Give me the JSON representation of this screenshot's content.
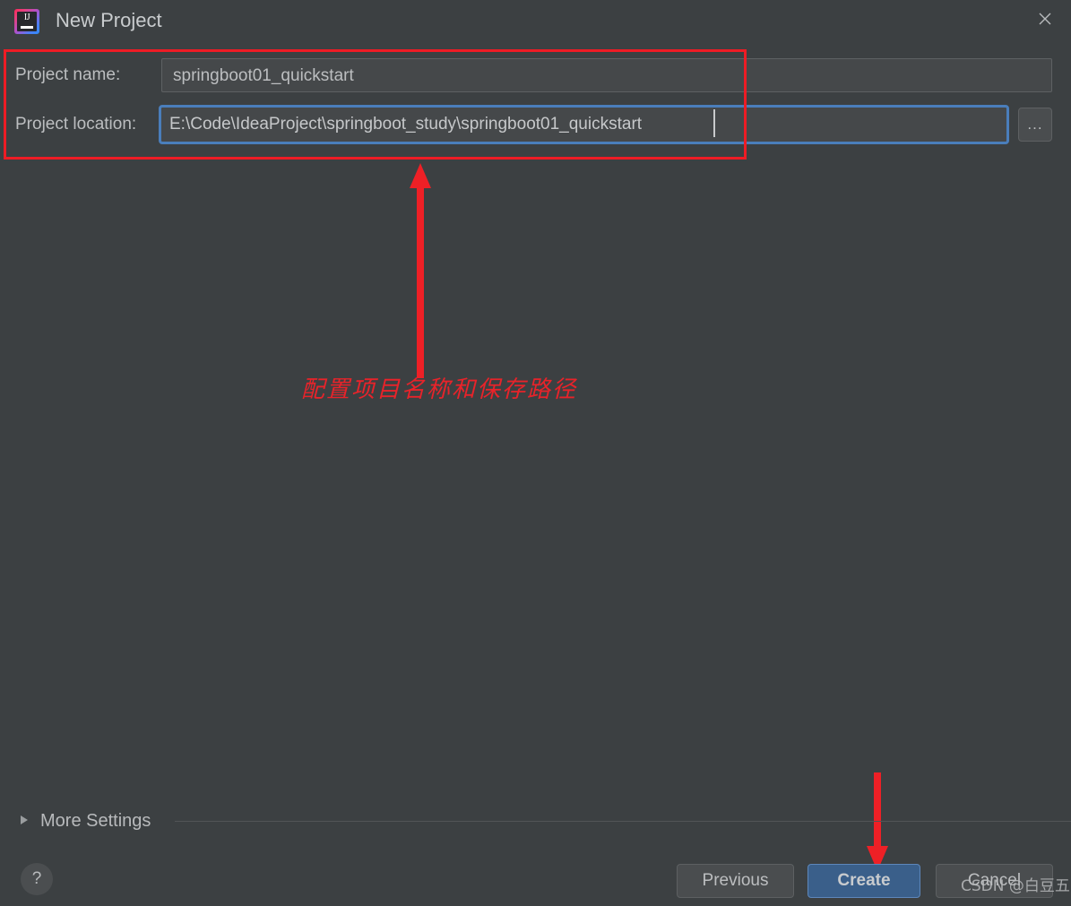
{
  "window": {
    "title": "New Project",
    "app_icon": "intellij-idea-icon",
    "icon_text": "IJ",
    "close_icon": "close-icon",
    "background_color": "#3c4042"
  },
  "form": {
    "name_label": "Project name:",
    "name_value": "springboot01_quickstart",
    "location_label": "Project location:",
    "location_value": "E:\\Code\\IdeaProject\\springboot_study\\springboot01_quickstart",
    "browse_label": "...",
    "focus_ring_color": "#4a7ebb"
  },
  "more_settings": {
    "label": "More Settings",
    "expander_icon": "chevron-right-icon",
    "expanded": false
  },
  "footer": {
    "help_label": "?",
    "previous_label": "Previous",
    "create_label": "Create",
    "cancel_label": "Cancel",
    "create_accent_color": "#3a5f8a"
  },
  "annotations": {
    "highlight_box_color": "#ee1c25",
    "note_text": "配置项目名称和保存路径",
    "arrow_up_icon": "arrow-up-icon",
    "arrow_down_icon": "arrow-down-icon"
  },
  "watermark": {
    "text": "CSDN @白豆五"
  }
}
